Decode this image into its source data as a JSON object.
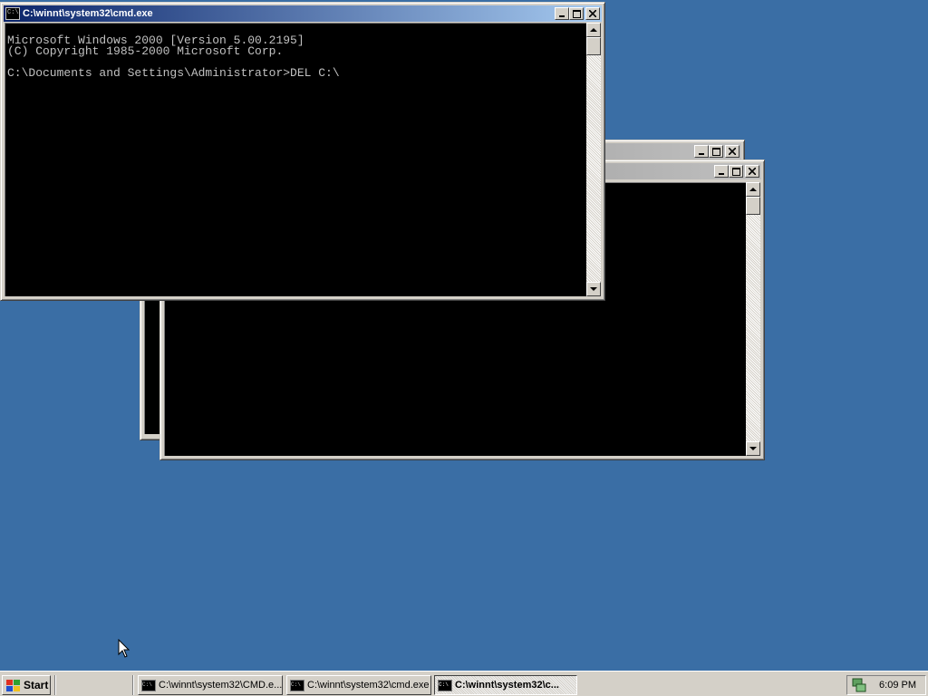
{
  "desktop": {
    "background": "#3a6ea5"
  },
  "windows": {
    "front": {
      "title": "C:\\winnt\\system32\\cmd.exe",
      "icon_text": "C:\\",
      "console_lines": [
        "Microsoft Windows 2000 [Version 5.00.2195]",
        "(C) Copyright 1985-2000 Microsoft Corp.",
        "",
        "C:\\Documents and Settings\\Administrator>DEL C:\\"
      ]
    },
    "middle": {
      "title": ""
    },
    "back": {
      "title": ""
    }
  },
  "taskbar": {
    "start_label": "Start",
    "tasks": [
      {
        "label": "C:\\winnt\\system32\\CMD.e...",
        "icon_text": "C:\\"
      },
      {
        "label": "C:\\winnt\\system32\\cmd.exe",
        "icon_text": "C:\\"
      },
      {
        "label": "C:\\winnt\\system32\\c...",
        "icon_text": "C:\\"
      }
    ],
    "clock": "6:09 PM"
  },
  "icons": [
    "minimize-icon",
    "maximize-icon",
    "close-icon",
    "scroll-up-icon",
    "scroll-down-icon",
    "windows-flag-icon",
    "network-tray-icon",
    "mouse-cursor-icon"
  ]
}
